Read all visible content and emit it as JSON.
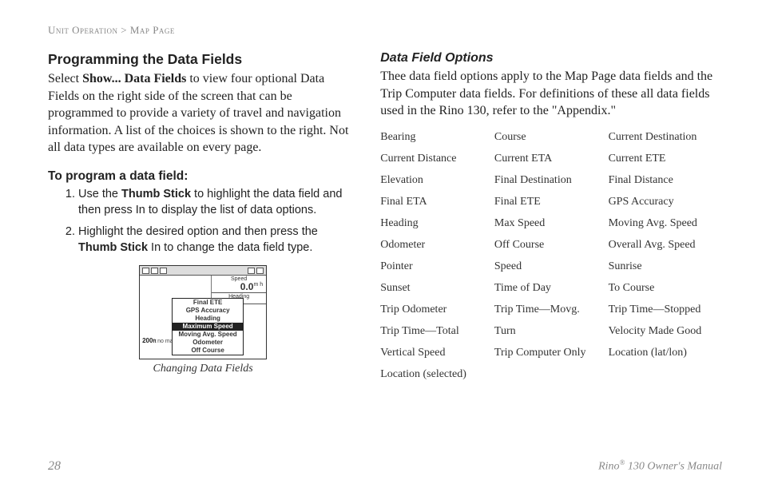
{
  "breadcrumb": {
    "section": "Unit Operation",
    "sep": ">",
    "page": "Map Page"
  },
  "left": {
    "heading": "Programming the Data Fields",
    "intro_prefix": "Select ",
    "intro_bold": "Show... Data Fields",
    "intro_suffix": " to view four optional Data Fields on the right side of the screen that can be programmed to provide a variety of travel and navigation information. A list of the choices is shown to the right. Not all data types are available on every page.",
    "sub_heading": "To program a data field:",
    "steps": [
      {
        "prefix": "Use the ",
        "bold": "Thumb Stick",
        "suffix": " to highlight the data field and then press In to display the list of data options."
      },
      {
        "prefix": "Highlight the desired option and then press the ",
        "bold": "Thumb Stick",
        "suffix": " In to change the data field type."
      }
    ],
    "screenshot": {
      "speed_label": "Speed",
      "speed_value": "0.0",
      "speed_unit": "m h",
      "heading_label": "Heading",
      "scale": "200",
      "scale_unit": "ft",
      "nomap": "no map",
      "menu": [
        {
          "label": "Final ETE",
          "selected": false
        },
        {
          "label": "GPS Accuracy",
          "selected": false
        },
        {
          "label": "Heading",
          "selected": false
        },
        {
          "label": "Maximum Speed",
          "selected": true
        },
        {
          "label": "Moving Avg. Speed",
          "selected": false
        },
        {
          "label": "Odometer",
          "selected": false
        },
        {
          "label": "Off Course",
          "selected": false
        }
      ]
    },
    "caption": "Changing Data Fields"
  },
  "right": {
    "heading": "Data Field Options",
    "description": "Thee data field options apply to the Map Page data fields and the Trip Computer data fields. For definitions of these all data fields used in the Rino 130, refer to the \"Appendix.\"",
    "options": [
      "Bearing",
      "Course",
      "Current Destination",
      "Current Distance",
      "Current ETA",
      "Current ETE",
      "Elevation",
      "Final Destination",
      "Final Distance",
      "Final ETA",
      "Final ETE",
      "GPS Accuracy",
      "Heading",
      "Max Speed",
      "Moving Avg. Speed",
      "Odometer",
      "Off Course",
      "Overall Avg. Speed",
      "Pointer",
      "Speed",
      "Sunrise",
      "Sunset",
      "Time of Day",
      "To Course",
      "Trip Odometer",
      "Trip Time—Movg.",
      "Trip Time—Stopped",
      "Trip Time—Total",
      "Turn",
      "Velocity Made Good",
      "Vertical Speed",
      "Trip Computer Only",
      "Location (lat/lon)",
      "Location (selected)",
      "",
      ""
    ]
  },
  "footer": {
    "page": "28",
    "manual_prefix": "Rino",
    "manual_reg": "®",
    "manual_suffix": " 130 Owner's Manual"
  }
}
